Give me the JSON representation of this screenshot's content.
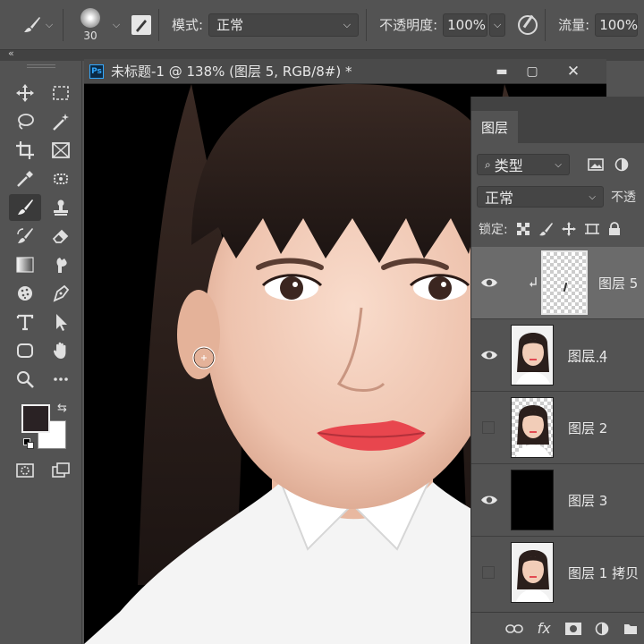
{
  "options_bar": {
    "brush_size": "30",
    "mode_label": "模式:",
    "mode_value": "正常",
    "opacity_label": "不透明度:",
    "opacity_value": "100%",
    "flow_label": "流量:",
    "flow_value": "100%"
  },
  "document": {
    "title": "未标题-1 @ 138% (图层 5, RGB/8#) *",
    "app_badge": "Ps"
  },
  "layers_panel": {
    "tab_label": "图层",
    "filter_kind": "类型",
    "blend_mode": "正常",
    "opacity_label": "不透",
    "lock_label": "锁定:",
    "fx_label": "fx",
    "layers": [
      {
        "name": "图层 5",
        "visible": true,
        "selected": true,
        "thumb": "transparent-stroke"
      },
      {
        "name": "图层 4",
        "visible": true,
        "selected": false,
        "thumb": "portrait"
      },
      {
        "name": "图层 2",
        "visible": false,
        "selected": false,
        "thumb": "portrait-transparent"
      },
      {
        "name": "图层 3",
        "visible": true,
        "selected": false,
        "thumb": "black"
      },
      {
        "name": "图层 1 拷贝",
        "visible": false,
        "selected": false,
        "thumb": "portrait"
      }
    ]
  },
  "colors": {
    "foreground": "#2a2224",
    "background": "#ffffff",
    "ui_bg": "#535353",
    "ps_blue": "#31a8ff"
  },
  "toolbar_icons": [
    "move-icon",
    "marquee-icon",
    "lasso-icon",
    "magic-wand-icon",
    "crop-icon",
    "frame-icon",
    "eyedropper-icon",
    "healing-icon",
    "brush-icon",
    "stamp-icon",
    "history-brush-icon",
    "eraser-icon",
    "gradient-icon",
    "smudge-icon",
    "sponge-icon",
    "pen-icon",
    "type-icon",
    "path-select-icon",
    "shape-icon",
    "hand-icon",
    "zoom-icon",
    "more-icon"
  ]
}
